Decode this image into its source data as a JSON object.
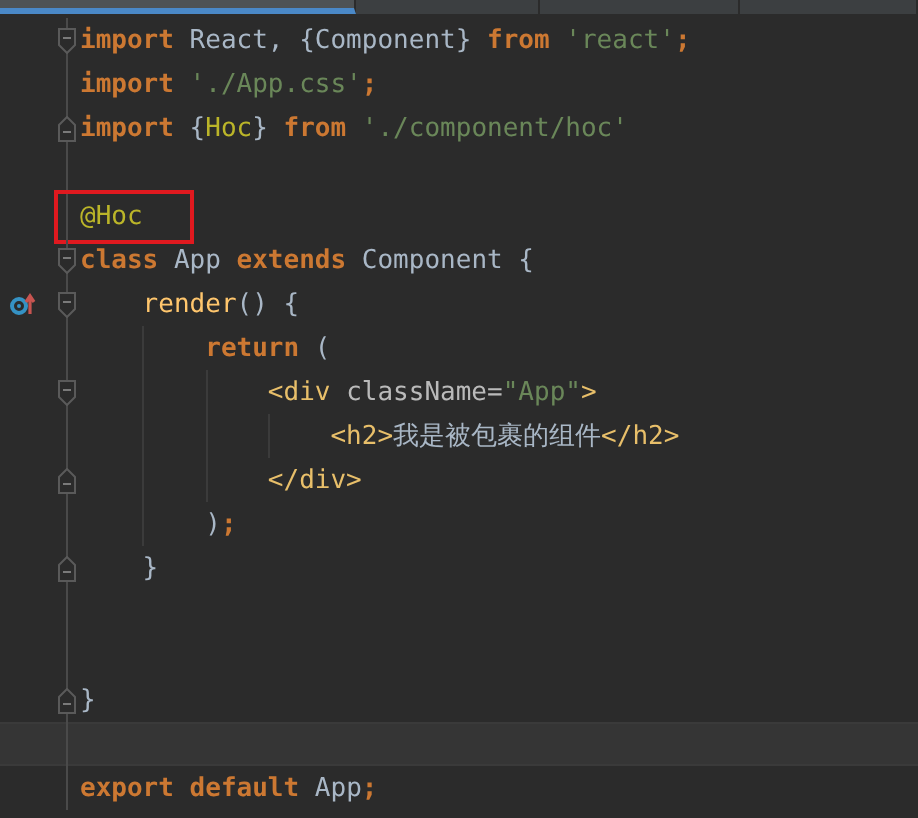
{
  "tabs": [
    {
      "selected": true
    },
    {
      "selected": false
    },
    {
      "selected": false
    },
    {
      "selected": false
    }
  ],
  "lines": [
    {
      "kind": "code",
      "fold_open": true,
      "tokens": [
        {
          "kind": "keyword",
          "text": "import"
        },
        {
          "kind": "ident",
          "text": " React, {Component} "
        },
        {
          "kind": "keyword",
          "text": "from"
        },
        {
          "kind": "string",
          "text": " 'react'"
        },
        {
          "kind": "keyword",
          "text": ";"
        }
      ]
    },
    {
      "kind": "code",
      "tokens": [
        {
          "kind": "keyword",
          "text": "import"
        },
        {
          "kind": "string",
          "text": " './App.css'"
        },
        {
          "kind": "keyword",
          "text": ";"
        }
      ]
    },
    {
      "kind": "code",
      "fold_close": true,
      "tokens": [
        {
          "kind": "keyword",
          "text": "import"
        },
        {
          "kind": "ident",
          "text": " {"
        },
        {
          "kind": "decorator",
          "text": "Hoc"
        },
        {
          "kind": "ident",
          "text": "} "
        },
        {
          "kind": "keyword",
          "text": "from"
        },
        {
          "kind": "string",
          "text": " './component/hoc'"
        }
      ]
    },
    {
      "kind": "blank"
    },
    {
      "kind": "code",
      "tokens": [
        {
          "kind": "decorator",
          "text": "@Hoc",
          "boxed": true
        }
      ]
    },
    {
      "kind": "code",
      "fold_open": true,
      "tokens": [
        {
          "kind": "keyword",
          "text": "class"
        },
        {
          "kind": "ident",
          "text": " App "
        },
        {
          "kind": "keyword",
          "text": "extends"
        },
        {
          "kind": "ident",
          "text": " Component {"
        }
      ]
    },
    {
      "kind": "code",
      "fold_open": true,
      "override_marker": true,
      "tokens": [
        {
          "kind": "function",
          "text": "    render"
        },
        {
          "kind": "ident",
          "text": "() {"
        }
      ]
    },
    {
      "kind": "code",
      "tokens": [
        {
          "kind": "keyword",
          "text": "        return"
        },
        {
          "kind": "ident",
          "text": " ("
        }
      ]
    },
    {
      "kind": "code",
      "fold_open": true,
      "tokens": [
        {
          "kind": "tag",
          "text": "            <div "
        },
        {
          "kind": "attr",
          "text": "className="
        },
        {
          "kind": "string",
          "text": "\"App\""
        },
        {
          "kind": "tag",
          "text": ">"
        }
      ]
    },
    {
      "kind": "code",
      "tokens": [
        {
          "kind": "tag",
          "text": "                <h2>"
        },
        {
          "kind": "ident",
          "text": "我是被包裹的组件"
        },
        {
          "kind": "tag",
          "text": "</h2>"
        }
      ]
    },
    {
      "kind": "code",
      "fold_close": true,
      "tokens": [
        {
          "kind": "tag",
          "text": "            </div>"
        }
      ]
    },
    {
      "kind": "code",
      "tokens": [
        {
          "kind": "ident",
          "text": "        )"
        },
        {
          "kind": "keyword",
          "text": ";"
        }
      ]
    },
    {
      "kind": "code",
      "fold_close": true,
      "tokens": [
        {
          "kind": "ident",
          "text": "    }"
        }
      ]
    },
    {
      "kind": "blank"
    },
    {
      "kind": "blank"
    },
    {
      "kind": "code",
      "fold_close": true,
      "tokens": [
        {
          "kind": "ident",
          "text": "}"
        }
      ]
    },
    {
      "kind": "caret_line"
    },
    {
      "kind": "code",
      "tokens": [
        {
          "kind": "keyword",
          "text": "export"
        },
        {
          "kind": "keyword",
          "text": " default"
        },
        {
          "kind": "ident",
          "text": " App"
        },
        {
          "kind": "keyword",
          "text": ";"
        }
      ]
    }
  ]
}
